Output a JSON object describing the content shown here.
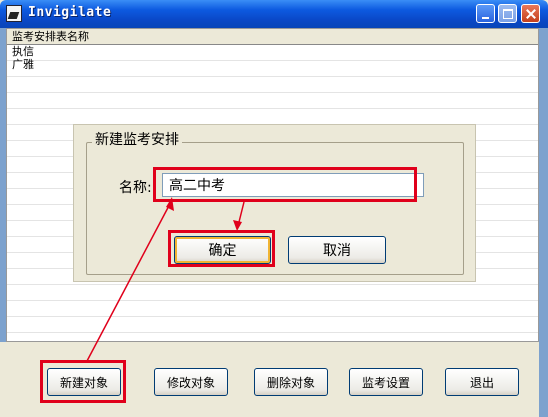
{
  "window": {
    "title": "Invigilate",
    "controls": {
      "minimize_icon": "minimize-icon",
      "maximize_icon": "maximize-icon",
      "close_icon": "close-icon"
    }
  },
  "list": {
    "header": "监考安排表名称",
    "rows": [
      "执信",
      "广雅"
    ]
  },
  "dialog": {
    "group_title": "新建监考安排",
    "name_label": "名称:",
    "name_value": "高二中考",
    "ok_label": "确定",
    "cancel_label": "取消"
  },
  "toolbar": {
    "buttons": [
      "新建对象",
      "修改对象",
      "删除对象",
      "监考设置",
      "退出"
    ]
  },
  "annotation": {
    "highlight_color": "#e0001b"
  }
}
